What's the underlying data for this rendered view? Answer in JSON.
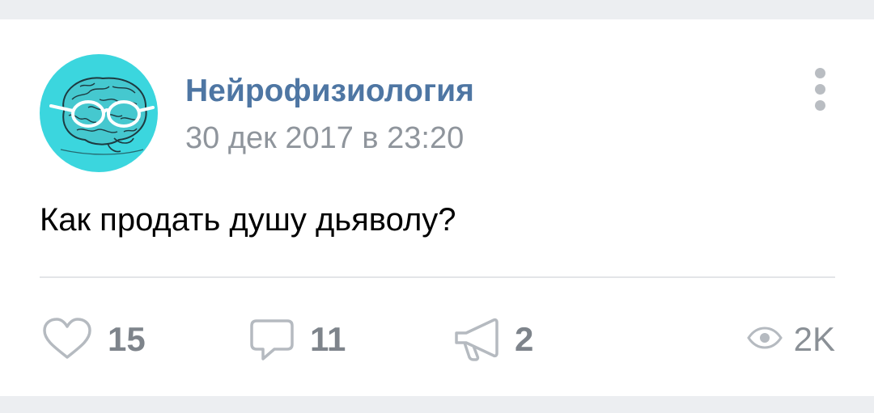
{
  "post": {
    "group_name": "Нейрофизиология",
    "date": "30 дек 2017 в 23:20",
    "text": "Как продать душу дьяволу?",
    "avatar_icon": "brain-with-glasses-icon",
    "avatar_color": "#3bd6de"
  },
  "actions": {
    "likes": "15",
    "comments": "11",
    "shares": "2",
    "views": "2K"
  },
  "colors": {
    "group_name": "#4e76a3",
    "secondary_text": "#8f959c",
    "icon": "#b5bac0",
    "background": "#eceef1"
  }
}
